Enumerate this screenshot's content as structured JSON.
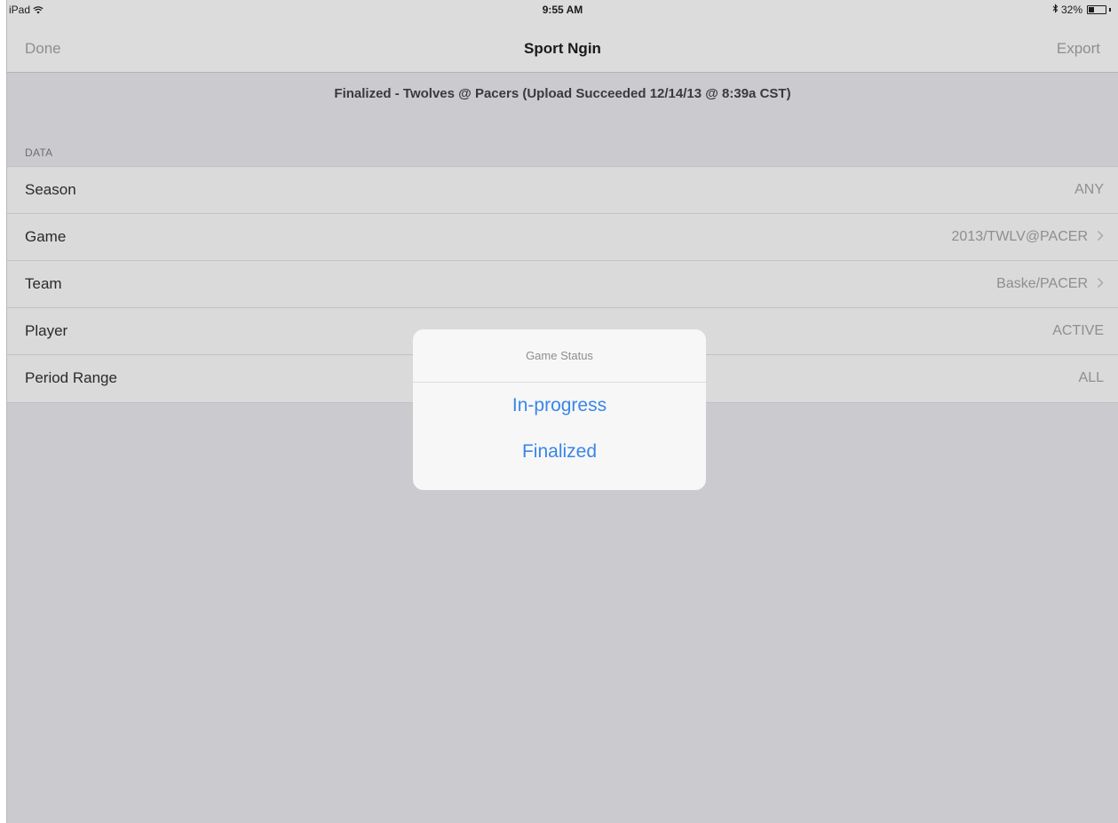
{
  "status_bar": {
    "device": "iPad",
    "time": "9:55 AM",
    "battery_percent": "32%",
    "battery_level": 0.32
  },
  "nav": {
    "left_button": "Done",
    "title": "Sport Ngin",
    "right_button": "Export"
  },
  "upload_status": "Finalized - Twolves @ Pacers  (Upload Succeeded 12/14/13 @ 8:39a CST)",
  "section": {
    "header": "DATA",
    "rows": [
      {
        "label": "Season",
        "value": "ANY",
        "chevron": false
      },
      {
        "label": "Game",
        "value": "2013/TWLV@PACER",
        "chevron": true
      },
      {
        "label": "Team",
        "value": "Baske/PACER",
        "chevron": true
      },
      {
        "label": "Player",
        "value": "ACTIVE",
        "chevron": false
      },
      {
        "label": "Period Range",
        "value": "ALL",
        "chevron": false
      }
    ]
  },
  "alert": {
    "title": "Game Status",
    "options": [
      "In-progress",
      "Finalized"
    ]
  },
  "colors": {
    "accent": "#3a86e6",
    "background": "#cbcbcf",
    "bar": "#dcdcdc"
  },
  "icons": {
    "wifi": "wifi-icon",
    "bluetooth": "bluetooth-icon",
    "battery": "battery-icon",
    "chevron": "chevron-right-icon"
  }
}
